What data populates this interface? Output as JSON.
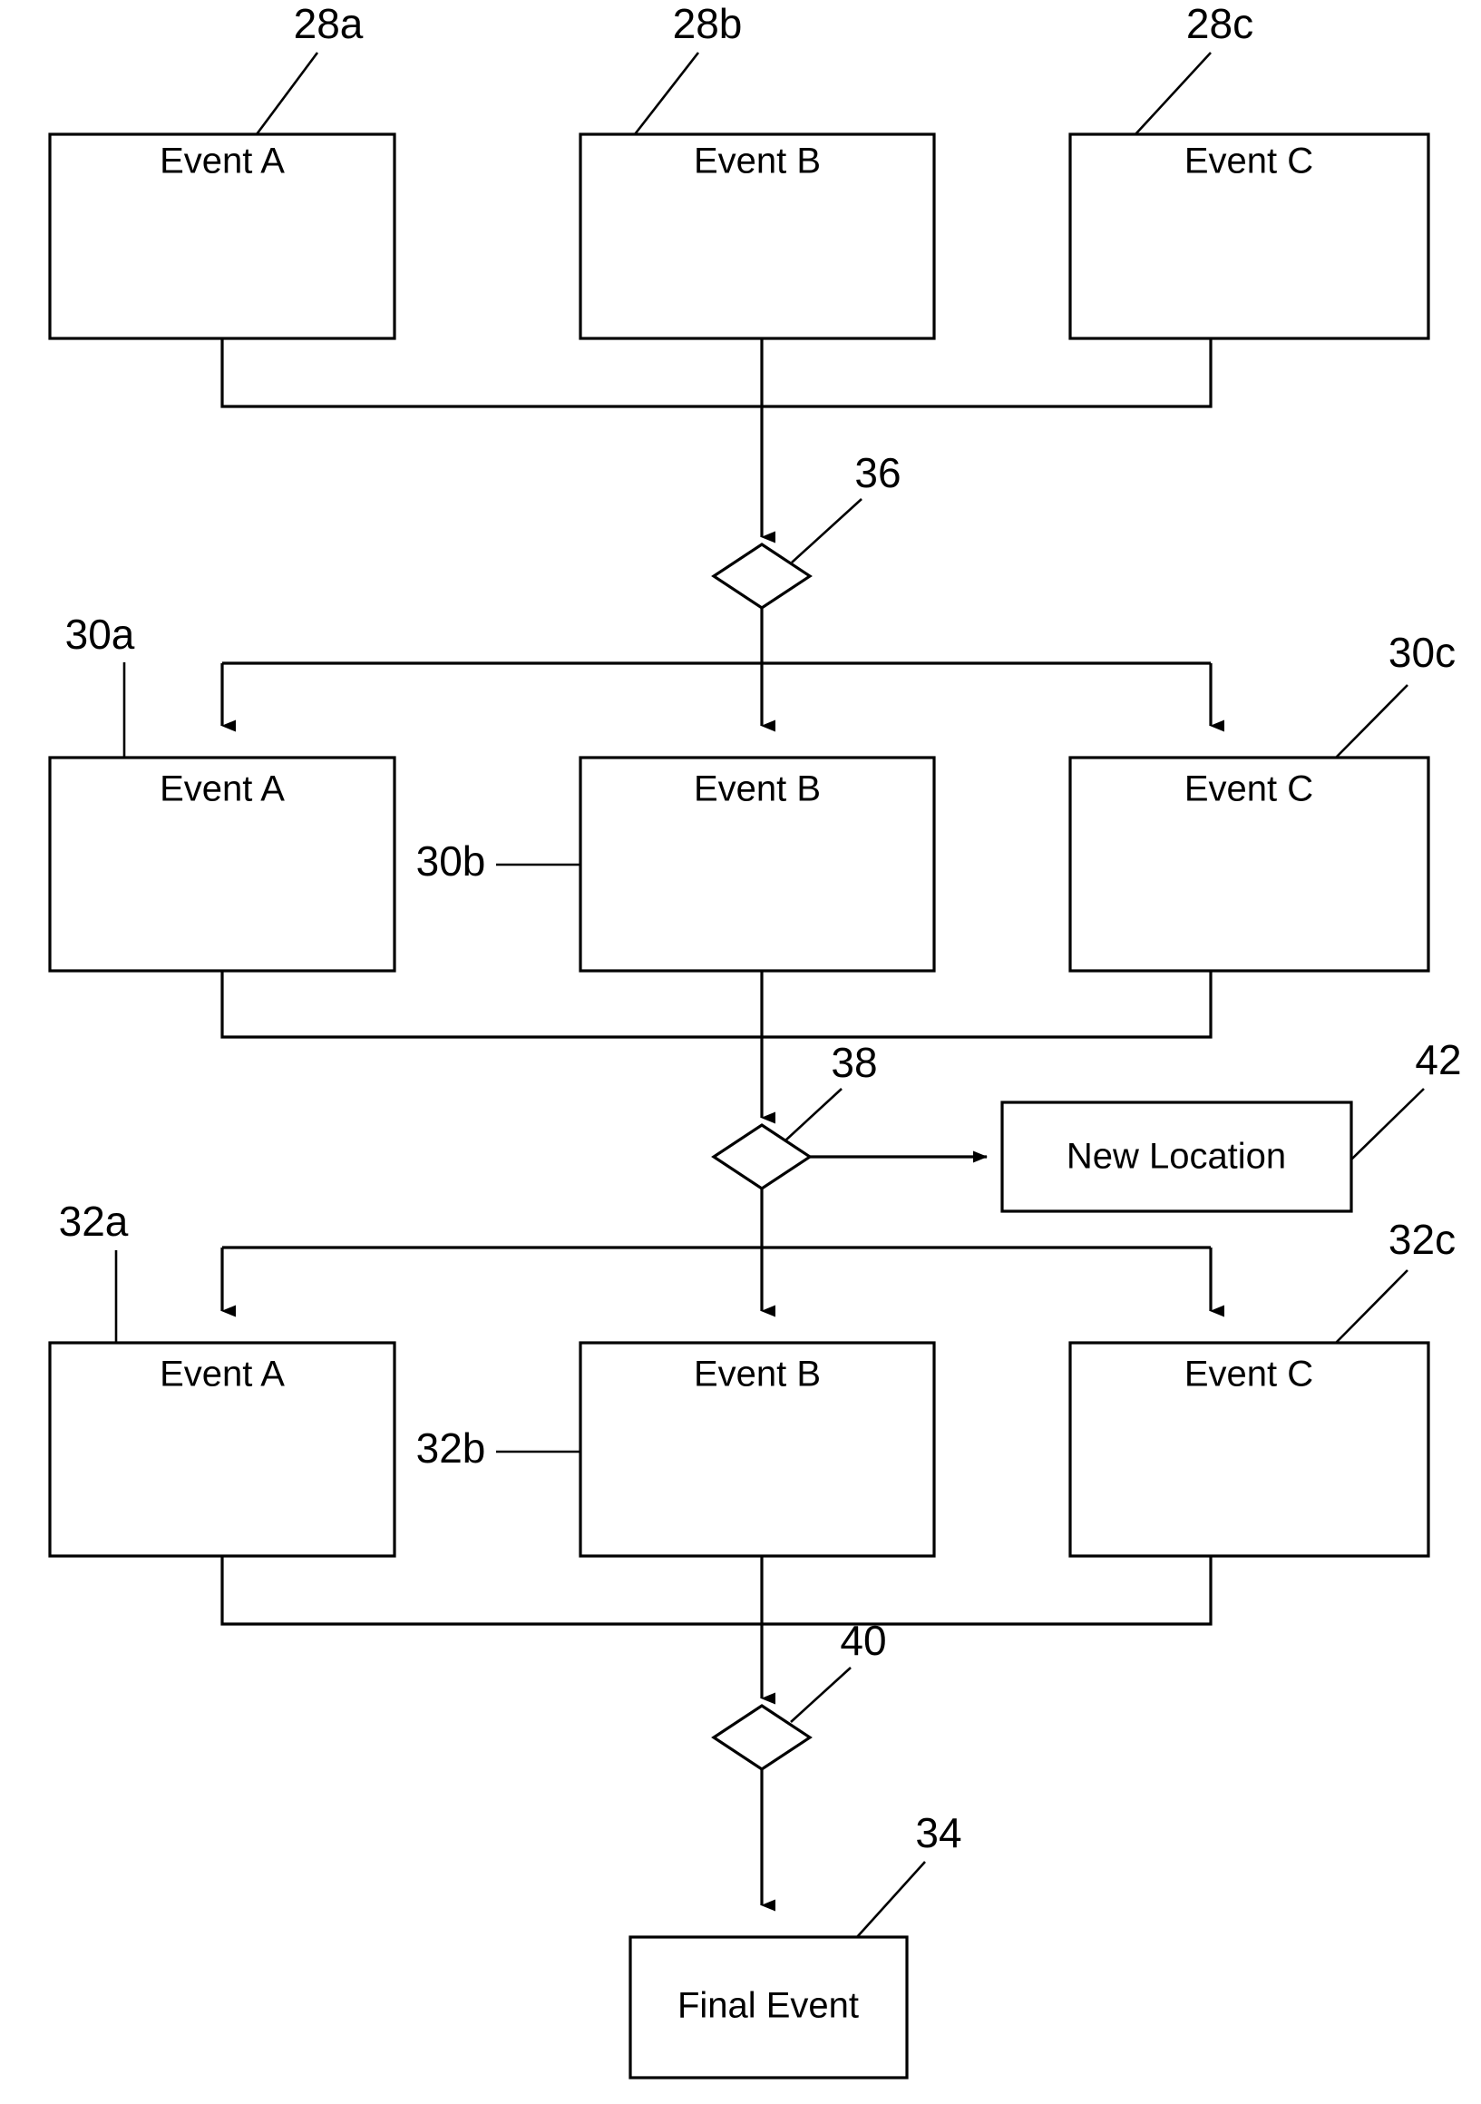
{
  "diagram": {
    "type": "patent-flowchart",
    "background_color": "#ffffff",
    "line_color": "#000000",
    "rows": [
      {
        "id": "row-1",
        "nodes": [
          {
            "ref": "28a",
            "label": "Event A"
          },
          {
            "ref": "28b",
            "label": "Event B"
          },
          {
            "ref": "28c",
            "label": "Event C"
          }
        ]
      },
      {
        "id": "row-2",
        "nodes": [
          {
            "ref": "30a",
            "label": "Event A"
          },
          {
            "ref": "30b",
            "label": "Event B"
          },
          {
            "ref": "30c",
            "label": "Event C"
          }
        ]
      },
      {
        "id": "row-3",
        "nodes": [
          {
            "ref": "32a",
            "label": "Event A"
          },
          {
            "ref": "32b",
            "label": "Event B"
          },
          {
            "ref": "32c",
            "label": "Event C"
          }
        ]
      }
    ],
    "decisions": [
      {
        "ref": "36",
        "label": ""
      },
      {
        "ref": "38",
        "label": ""
      },
      {
        "ref": "40",
        "label": ""
      }
    ],
    "side_node": {
      "ref": "42",
      "label": "New Location"
    },
    "terminal_node": {
      "ref": "34",
      "label": "Final Event"
    },
    "refs": {
      "r28a": "28a",
      "r28b": "28b",
      "r28c": "28c",
      "r30a": "30a",
      "r30b": "30b",
      "r30c": "30c",
      "r32a": "32a",
      "r32b": "32b",
      "r32c": "32c",
      "r34": "34",
      "r36": "36",
      "r38": "38",
      "r40": "40",
      "r42": "42"
    },
    "labels": {
      "event_a": "Event A",
      "event_b": "Event B",
      "event_c": "Event C",
      "new_location": "New Location",
      "final_event": "Final Event"
    }
  }
}
